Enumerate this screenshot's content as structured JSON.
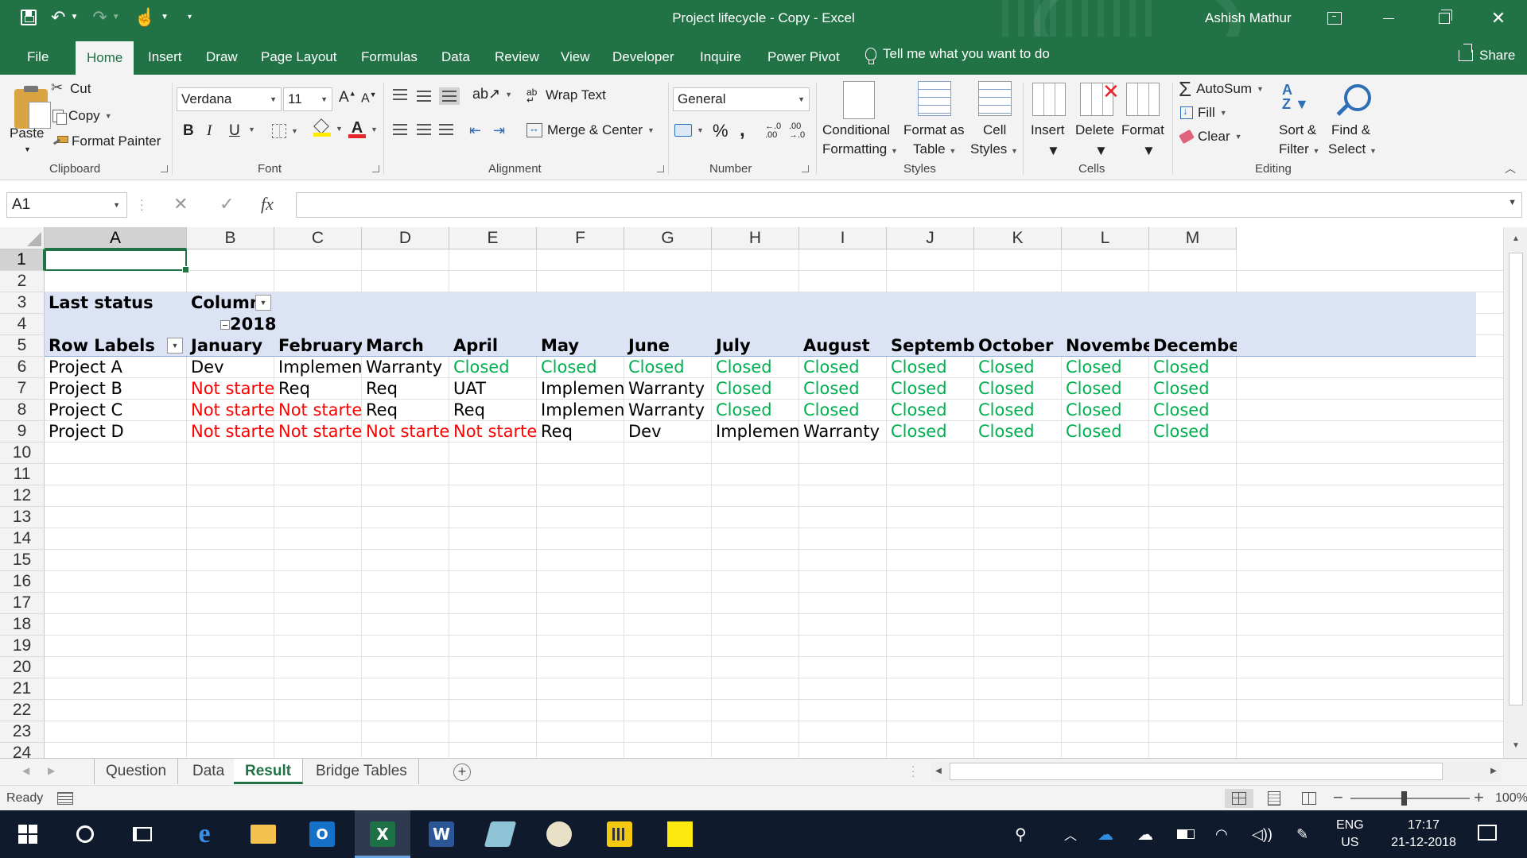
{
  "window": {
    "title": "Project lifecycle - Copy  -  Excel",
    "user": "Ashish Mathur"
  },
  "ribbon_tabs": [
    "File",
    "Home",
    "Insert",
    "Draw",
    "Page Layout",
    "Formulas",
    "Data",
    "Review",
    "View",
    "Developer",
    "Inquire",
    "Power Pivot"
  ],
  "active_tab": "Home",
  "tell_me": "Tell me what you want to do",
  "share": "Share",
  "clipboard": {
    "paste": "Paste",
    "cut": "Cut",
    "copy": "Copy",
    "format_painter": "Format Painter",
    "label": "Clipboard"
  },
  "font": {
    "name": "Verdana",
    "size": "11",
    "bold": "B",
    "italic": "I",
    "underline": "U",
    "label": "Font",
    "fill_color": "#ffeb00",
    "font_color": "#e8262a"
  },
  "alignment": {
    "wrap_text": "Wrap Text",
    "merge_center": "Merge & Center",
    "label": "Alignment"
  },
  "number": {
    "format": "General",
    "percent": "%",
    "comma": ",",
    "label": "Number"
  },
  "styles": {
    "conditional_1": "Conditional",
    "conditional_2": "Formatting",
    "format_as_1": "Format as",
    "format_as_2": "Table",
    "cell_styles_1": "Cell",
    "cell_styles_2": "Styles",
    "label": "Styles"
  },
  "cells_group": {
    "insert": "Insert",
    "delete": "Delete",
    "format": "Format",
    "label": "Cells"
  },
  "editing": {
    "autosum": "AutoSum",
    "fill": "Fill",
    "clear": "Clear",
    "sort_1": "Sort &",
    "sort_2": "Filter",
    "find_1": "Find &",
    "find_2": "Select",
    "label": "Editing"
  },
  "formula_bar": {
    "name_box": "A1",
    "fx": "fx",
    "formula": ""
  },
  "columns": [
    "A",
    "B",
    "C",
    "D",
    "E",
    "F",
    "G",
    "H",
    "I",
    "J",
    "K",
    "L",
    "M"
  ],
  "rows": [
    "1",
    "2",
    "3",
    "4",
    "5",
    "6",
    "7",
    "8",
    "9",
    "10",
    "11",
    "12",
    "13",
    "14",
    "15",
    "16",
    "17",
    "18",
    "19",
    "20",
    "21",
    "22",
    "23",
    "24"
  ],
  "pivot": {
    "values_label": "Last status",
    "column_label": "Column",
    "year": "2018",
    "row_labels": "Row Labels",
    "months": [
      "January",
      "February",
      "March",
      "April",
      "May",
      "June",
      "July",
      "August",
      "September",
      "October",
      "November",
      "December"
    ],
    "projects": [
      {
        "name": "Project A",
        "values": [
          "Dev",
          "Implement",
          "Warranty",
          "Closed",
          "Closed",
          "Closed",
          "Closed",
          "Closed",
          "Closed",
          "Closed",
          "Closed",
          "Closed"
        ]
      },
      {
        "name": "Project B",
        "values": [
          "Not started",
          "Req",
          "Req",
          "UAT",
          "Implement",
          "Warranty",
          "Closed",
          "Closed",
          "Closed",
          "Closed",
          "Closed",
          "Closed"
        ]
      },
      {
        "name": "Project C",
        "values": [
          "Not started",
          "Not started",
          "Req",
          "Req",
          "Implement",
          "Warranty",
          "Closed",
          "Closed",
          "Closed",
          "Closed",
          "Closed",
          "Closed"
        ]
      },
      {
        "name": "Project D",
        "values": [
          "Not started",
          "Not started",
          "Not started",
          "Not started",
          "Req",
          "Dev",
          "Implement",
          "Warranty",
          "Closed",
          "Closed",
          "Closed",
          "Closed"
        ]
      }
    ],
    "status_colors": {
      "Not started": "#ff0000",
      "Closed": "#00b050"
    }
  },
  "sheets": [
    "Question",
    "Data",
    "Result",
    "Bridge Tables"
  ],
  "active_sheet": "Result",
  "status": {
    "ready": "Ready",
    "zoom": "100%"
  },
  "taskbar": {
    "lang_1": "ENG",
    "lang_2": "US",
    "time": "17:17",
    "date": "21-12-2018"
  }
}
